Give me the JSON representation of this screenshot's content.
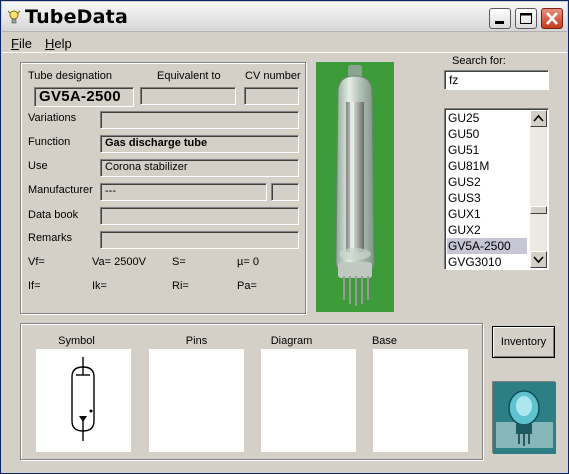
{
  "window": {
    "title": "TubeData",
    "icon": "lightbulb-icon"
  },
  "titlebar_buttons": {
    "minimize_icon": "minimize-icon",
    "maximize_icon": "maximize-icon",
    "close_icon": "close-icon"
  },
  "menu": {
    "items": [
      {
        "label": "File",
        "accel": "F",
        "rest": "ile"
      },
      {
        "label": "Help",
        "accel": "H",
        "rest": "elp"
      }
    ]
  },
  "details": {
    "tube_designation_label": "Tube designation",
    "equivalent_label": "Equivalent to",
    "cv_label": "CV number",
    "tube_designation": "GV5A-2500",
    "equivalent": "",
    "cv_number": "",
    "variations_label": "Variations",
    "variations": "",
    "function_label": "Function",
    "function": "Gas discharge tube",
    "use_label": "Use",
    "use": "Corona stabilizer",
    "manufacturer_label": "Manufacturer",
    "manufacturer": "---",
    "manufacturer_extra": "",
    "databook_label": "Data book",
    "databook": "",
    "remarks_label": "Remarks",
    "remarks": ""
  },
  "params": {
    "vf": "Vf=",
    "va": "Va=  2500V",
    "s": "S=",
    "mu": "µ=     0",
    "if": "If=",
    "ik": "Ik=",
    "ri": "Ri=",
    "pa": "Pa="
  },
  "search": {
    "label": "Search for:",
    "value": "fz",
    "results": [
      "GU25",
      "GU50",
      "GU51",
      "GU81M",
      "GUS2",
      "GUS3",
      "GUX1",
      "GUX2",
      "GV5A-2500",
      "GVG3010"
    ],
    "selected": "GV5A-2500"
  },
  "bottom": {
    "symbol_label": "Symbol",
    "pins_label": "Pins",
    "diagram_label": "Diagram",
    "base_label": "Base"
  },
  "inventory_button": "Inventory",
  "colors": {
    "photo_bg": "#3e9b3a",
    "logo_bg": "#2d7f86",
    "list_selection": "#c6c6d6"
  }
}
